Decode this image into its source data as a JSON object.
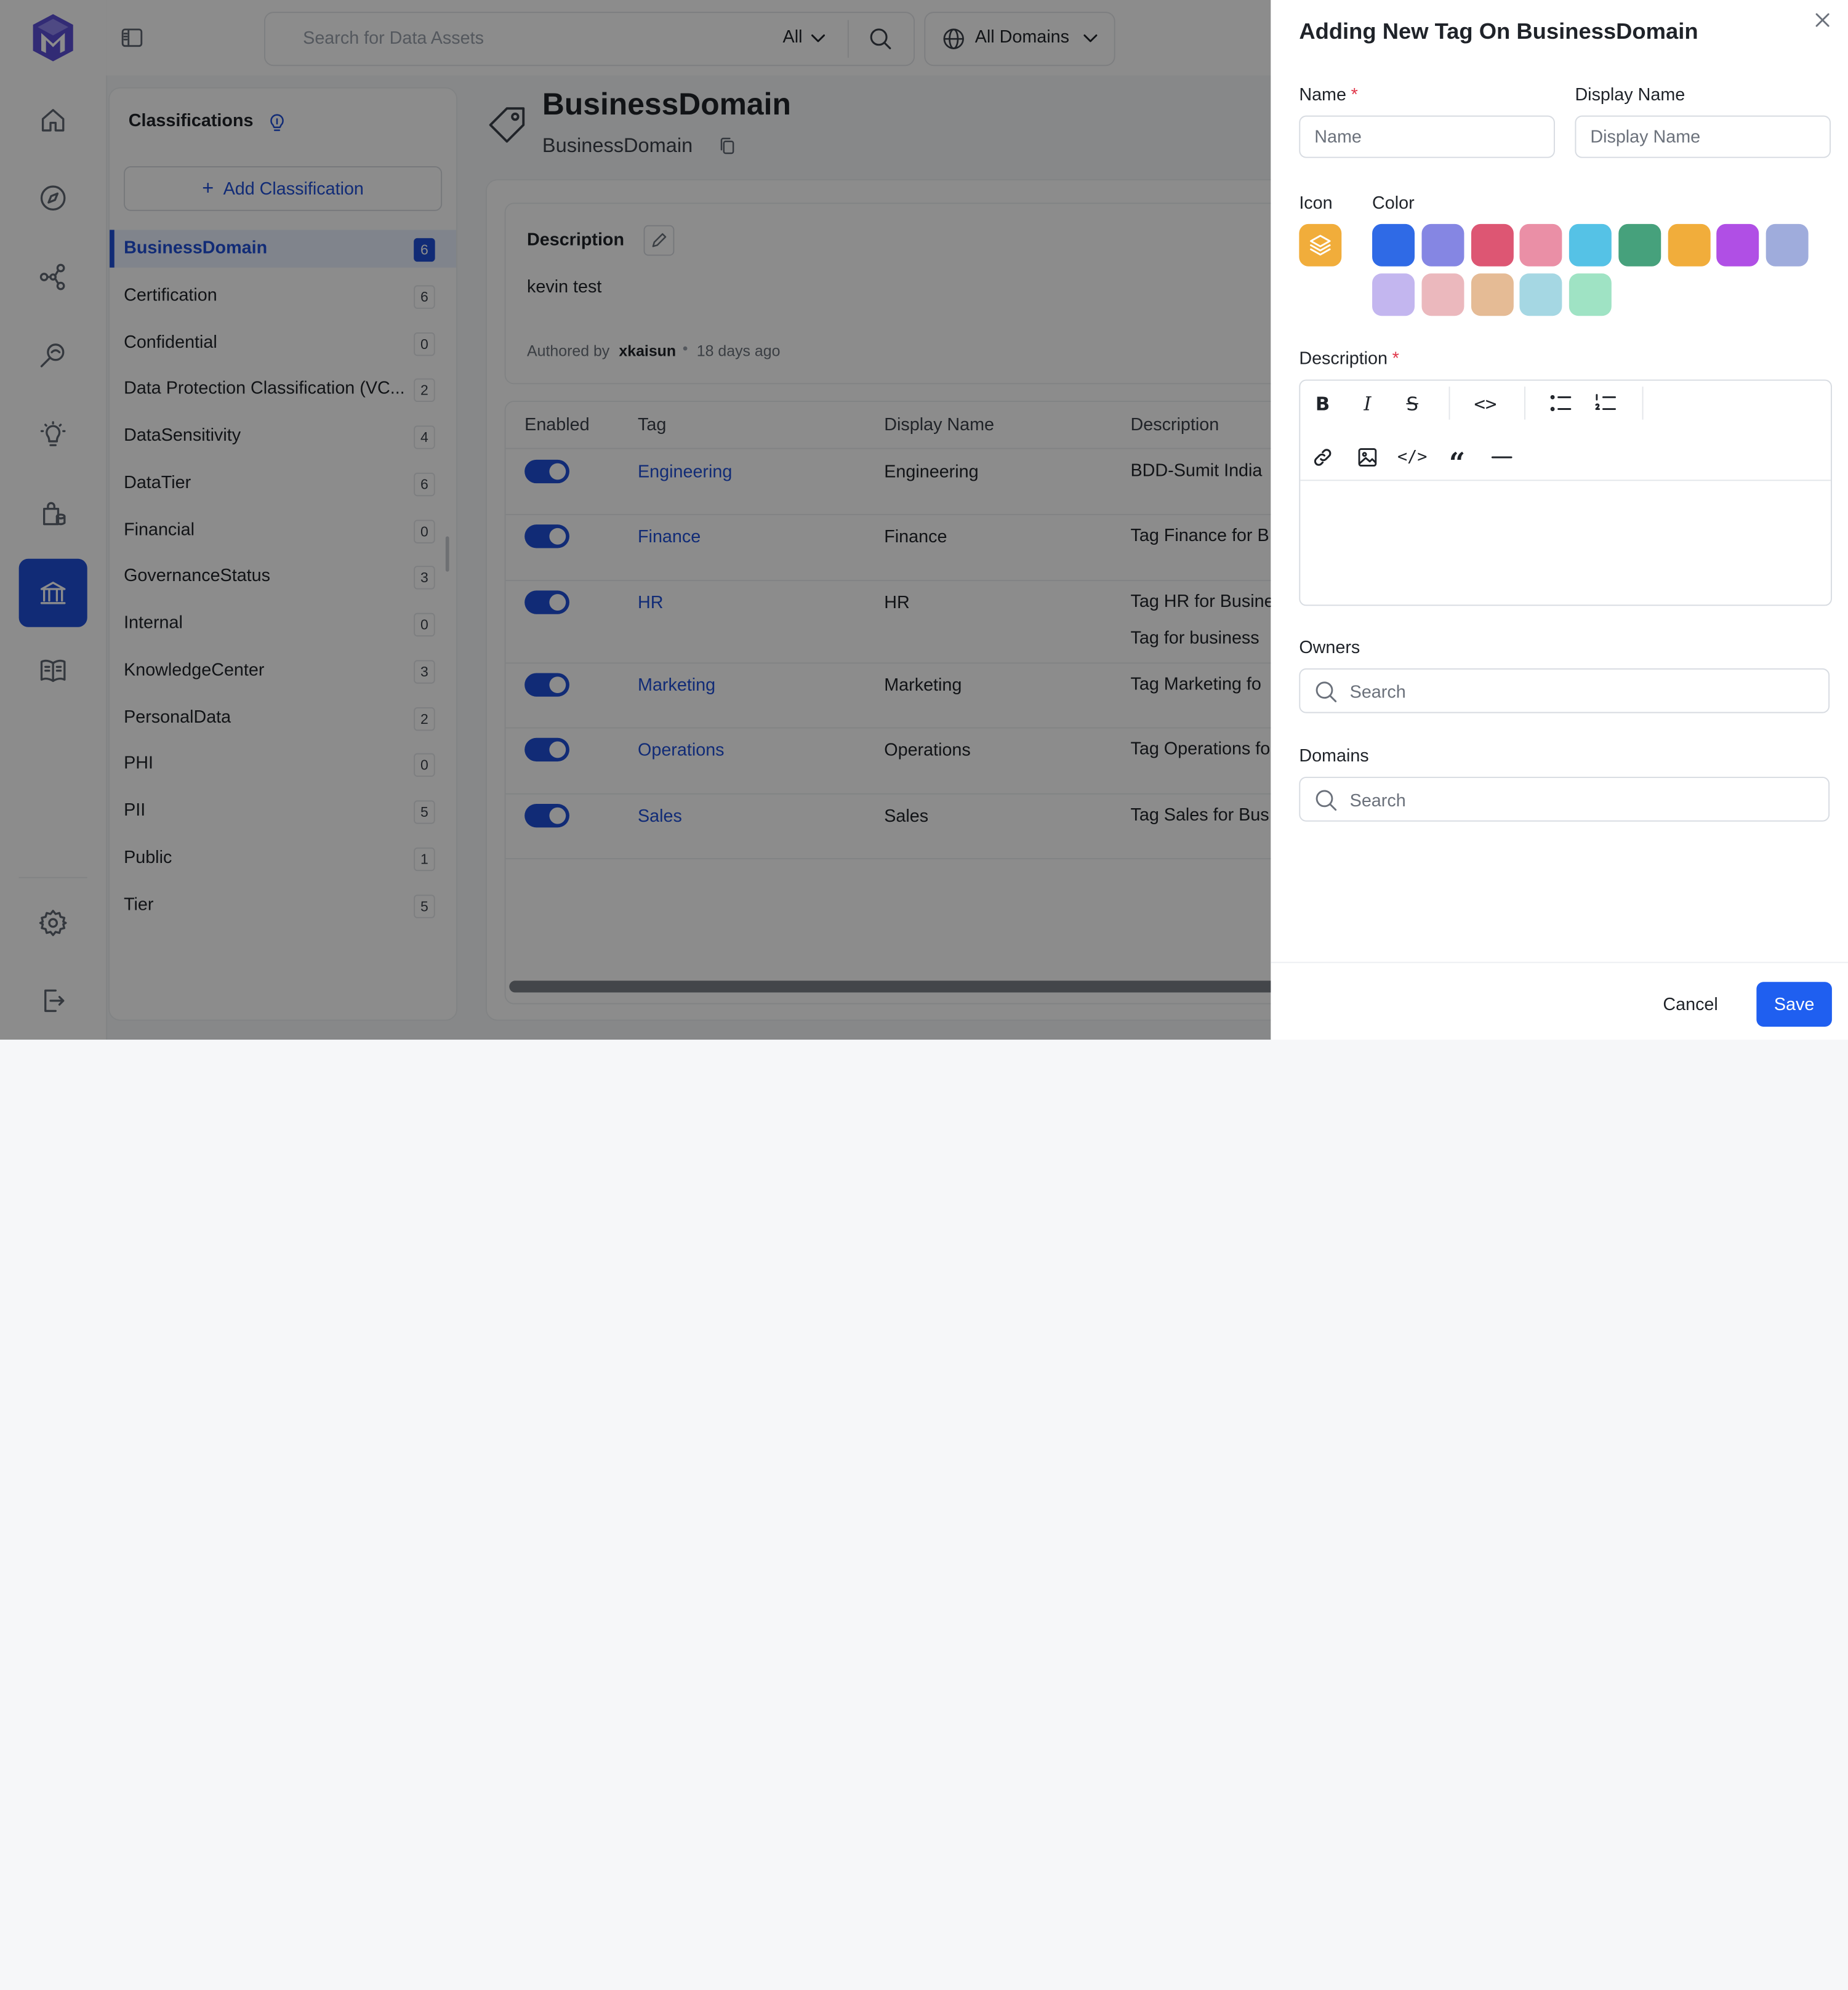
{
  "topbar": {
    "search_placeholder": "Search for Data Assets",
    "search_filter": "All",
    "domain_selector": "All Domains"
  },
  "classifications": {
    "title": "Classifications",
    "add_button": "Add Classification",
    "items": [
      {
        "label": "BusinessDomain",
        "count": "6",
        "selected": true
      },
      {
        "label": "Certification",
        "count": "6"
      },
      {
        "label": "Confidential",
        "count": "0"
      },
      {
        "label": "Data Protection Classification (VC...",
        "count": "2"
      },
      {
        "label": "DataSensitivity",
        "count": "4"
      },
      {
        "label": "DataTier",
        "count": "6"
      },
      {
        "label": "Financial",
        "count": "0"
      },
      {
        "label": "GovernanceStatus",
        "count": "3"
      },
      {
        "label": "Internal",
        "count": "0"
      },
      {
        "label": "KnowledgeCenter",
        "count": "3"
      },
      {
        "label": "PersonalData",
        "count": "2"
      },
      {
        "label": "PHI",
        "count": "0"
      },
      {
        "label": "PII",
        "count": "5"
      },
      {
        "label": "Public",
        "count": "1"
      },
      {
        "label": "Tier",
        "count": "5"
      }
    ]
  },
  "main": {
    "title": "BusinessDomain",
    "subtitle": "BusinessDomain",
    "description_label": "Description",
    "description_text": "kevin test",
    "authored_by_prefix": "Authored by",
    "author": "xkaisun",
    "time_ago": "18 days ago",
    "columns": [
      "Enabled",
      "Tag",
      "Display Name",
      "Description"
    ],
    "rows": [
      {
        "tag": "Engineering",
        "display": "Engineering",
        "desc": "BDD-Sumit India"
      },
      {
        "tag": "Finance",
        "display": "Finance",
        "desc": "Tag Finance for B"
      },
      {
        "tag": "HR",
        "display": "HR",
        "desc": "Tag HR for Busine",
        "desc2": "Tag for business"
      },
      {
        "tag": "Marketing",
        "display": "Marketing",
        "desc": "Tag Marketing fo"
      },
      {
        "tag": "Operations",
        "display": "Operations",
        "desc": "Tag Operations fo"
      },
      {
        "tag": "Sales",
        "display": "Sales",
        "desc": "Tag Sales for Bus"
      }
    ]
  },
  "drawer": {
    "title": "Adding New Tag On BusinessDomain",
    "name_label": "Name",
    "name_placeholder": "Name",
    "display_name_label": "Display Name",
    "display_name_placeholder": "Display Name",
    "required_mark": "*",
    "icon_label": "Icon",
    "color_label": "Color",
    "colors": [
      "#2f6ae6",
      "#8586e3",
      "#dd5673",
      "#ea8fa6",
      "#55c2e6",
      "#46a17c",
      "#f1ad3b",
      "#b04fe5",
      "#9facdc",
      "#c3b6ef",
      "#ebb8bd",
      "#e5bb95",
      "#a5d7e3",
      "#9fe3c4"
    ],
    "icon_color": "#f1ad3b",
    "description_label": "Description",
    "owners_label": "Owners",
    "owners_placeholder": "Search",
    "domains_label": "Domains",
    "domains_placeholder": "Search",
    "cancel": "Cancel",
    "save": "Save"
  }
}
